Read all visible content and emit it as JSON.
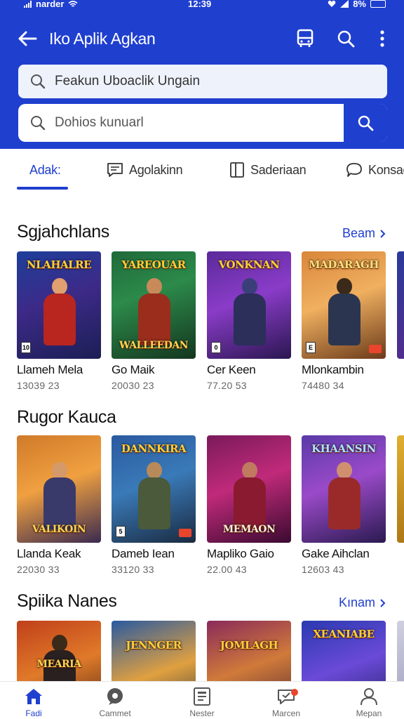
{
  "status_bar": {
    "carrier": "narder",
    "time": "12:39",
    "battery": "8%"
  },
  "app_bar": {
    "title": "Iko Aplik Agkan"
  },
  "search": {
    "primary_placeholder": "Feakun Uboaclik Ungain",
    "secondary_placeholder": "Dohios kunuarl"
  },
  "tabs": [
    {
      "label": "Adak:",
      "icon": "none",
      "active": true
    },
    {
      "label": "Agolakinn",
      "icon": "chat-icon",
      "active": false
    },
    {
      "label": "Saderiaan",
      "icon": "book-icon",
      "active": false
    },
    {
      "label": "Konsac",
      "icon": "comment-icon",
      "active": false
    }
  ],
  "sections": [
    {
      "title": "Sgjahchlans",
      "more": "Beam",
      "cards": [
        {
          "name": "Llameh Mela",
          "meta": "13039 23",
          "banner": "NLAHALRE",
          "banner2": "",
          "badge": "10"
        },
        {
          "name": "Go Maik",
          "meta": "20030 23",
          "banner": "YAREOUAR",
          "banner2": "WALLEEDAN",
          "badge": ""
        },
        {
          "name": "Cer Keen",
          "meta": "77.20 53",
          "banner": "VONKNAN",
          "banner2": "",
          "badge": "0"
        },
        {
          "name": "Mlonkambin",
          "meta": "74480 34",
          "banner": "MADARAGH",
          "banner2": "",
          "badge": "E"
        }
      ]
    },
    {
      "title": "Rugor Kauca",
      "more": "",
      "cards": [
        {
          "name": "Llanda Keak",
          "meta": "22030 33",
          "banner": "",
          "banner2": "VALIKOIN",
          "badge": ""
        },
        {
          "name": "Dameb Iean",
          "meta": "33120 33",
          "banner": "DANNKIRA",
          "banner2": "",
          "badge": "5"
        },
        {
          "name": "Mapliko Gaio",
          "meta": "22.00 43",
          "banner": "",
          "banner2": "MEMAON",
          "badge": ""
        },
        {
          "name": "Gake Aihclan",
          "meta": "12603 43",
          "banner": "KHAANSIN",
          "banner2": "",
          "badge": ""
        }
      ]
    },
    {
      "title": "Spiika Nanes",
      "more": "Kınam",
      "cards": [
        {
          "name": "",
          "meta": "",
          "banner": "",
          "banner2": "MEARIA",
          "badge": ""
        },
        {
          "name": "",
          "meta": "",
          "banner": "JENNGER",
          "banner2": "",
          "badge": ""
        },
        {
          "name": "",
          "meta": "",
          "banner": "JOMLAGH",
          "banner2": "",
          "badge": ""
        },
        {
          "name": "",
          "meta": "",
          "banner": "XEANIABE",
          "banner2": "",
          "badge": ""
        }
      ]
    }
  ],
  "bottom_nav": [
    {
      "label": "Fadi",
      "icon": "home-icon",
      "active": true
    },
    {
      "label": "Cammet",
      "icon": "chat-bubble-icon",
      "active": false
    },
    {
      "label": "Nester",
      "icon": "document-icon",
      "active": false
    },
    {
      "label": "Marcen",
      "icon": "notification-chat-icon",
      "active": false
    },
    {
      "label": "Mepan",
      "icon": "profile-icon",
      "active": false
    }
  ],
  "colors": {
    "primary": "#1f3fcf",
    "accent_badge": "#e8452c"
  }
}
